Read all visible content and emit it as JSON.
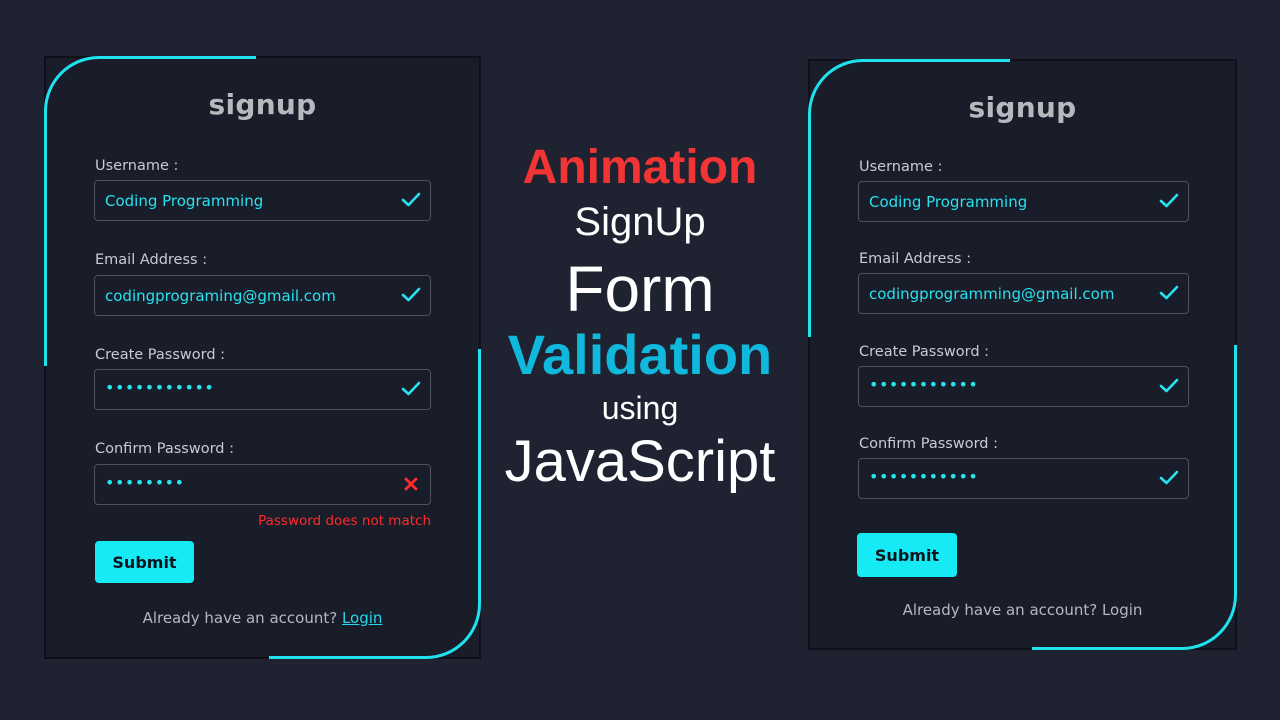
{
  "colors": {
    "background": "#1f2331",
    "card": "#191d29",
    "accent": "#1ee3ee",
    "valid": "#27e2ef",
    "error": "#ff2a2a",
    "heading_red": "#f23434",
    "heading_cyan": "#0fb8dc"
  },
  "center_title": {
    "line1": "Animation",
    "line2": "SignUp",
    "line3": "Form",
    "line4": "Validation",
    "line5": "using",
    "line6": "JavaScript"
  },
  "left_form": {
    "title": "signup",
    "username_label": "Username :",
    "username_value": "Coding Programming",
    "email_label": "Email Address :",
    "email_value": "codingprograming@gmail.com",
    "password_label": "Create Password :",
    "password_value": "•••••••••••",
    "confirm_label": "Confirm Password :",
    "confirm_value": "••••••••",
    "confirm_error": "Password does not match",
    "submit_label": "Submit",
    "footer_text": "Already have an account?",
    "login_link": "Login",
    "status_icons": [
      "check-icon",
      "check-icon",
      "check-icon",
      "cross-icon"
    ]
  },
  "right_form": {
    "title": "signup",
    "username_label": "Username :",
    "username_value": "Coding Programming",
    "email_label": "Email Address :",
    "email_value": "codingprogramming@gmail.com",
    "password_label": "Create Password :",
    "password_value": "•••••••••••",
    "confirm_label": "Confirm Password :",
    "confirm_value": "•••••••••••",
    "submit_label": "Submit",
    "footer_text": "Already have an account?",
    "login_link": "Login",
    "status_icons": [
      "check-icon",
      "check-icon",
      "check-icon",
      "check-icon"
    ]
  }
}
